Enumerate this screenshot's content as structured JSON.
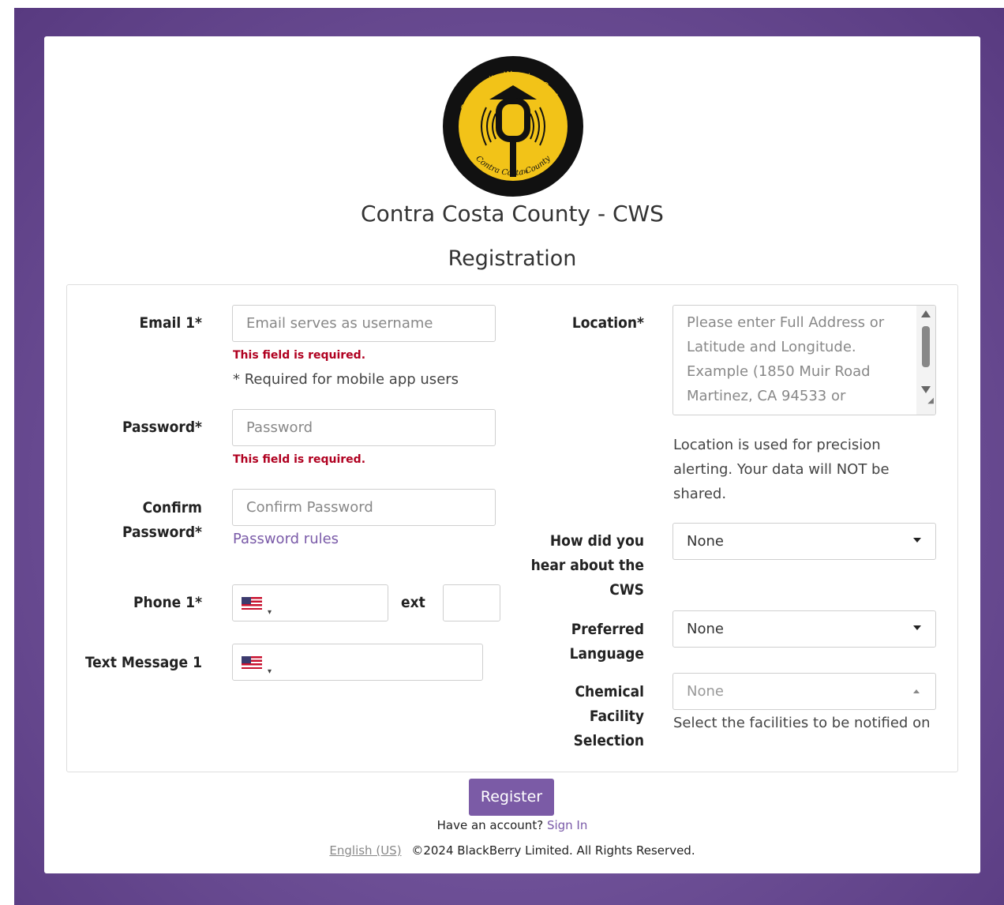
{
  "header": {
    "logo_text_top": "Community Warning System",
    "logo_text_bottom": "Contra Costa County",
    "logo_tm": "TM",
    "app_title": "Contra Costa County - CWS",
    "page_heading": "Registration"
  },
  "form": {
    "email": {
      "label": "Email 1*",
      "placeholder": "Email serves as username",
      "error": "This field is required.",
      "hint": "* Required for mobile app users"
    },
    "password": {
      "label": "Password*",
      "placeholder": "Password",
      "error": "This field is required."
    },
    "confirm_password": {
      "label_line1": "Confirm",
      "label_line2": "Password*",
      "placeholder": "Confirm Password",
      "rules_link": "Password rules"
    },
    "phone": {
      "label": "Phone 1*",
      "ext_label": "ext",
      "ext_value": ""
    },
    "text_message": {
      "label": "Text Message 1"
    },
    "location": {
      "label": "Location*",
      "placeholder": "Please enter Full Address or Latitude and Longitude. Example (1850 Muir Road Martinez,  CA 94533 or",
      "hint": "Location is used for precision alerting. Your data will NOT be shared."
    },
    "how_heard": {
      "label_line1": "How did you",
      "label_line2": "hear about the",
      "label_line3": "CWS",
      "value": "None"
    },
    "preferred_language": {
      "label_line1": "Preferred",
      "label_line2": "Language",
      "value": "None"
    },
    "chemical_facility": {
      "label_line1": "Chemical",
      "label_line2": "Facility",
      "label_line3": "Selection",
      "value": "None",
      "hint": "Select the facilities to be notified on"
    }
  },
  "actions": {
    "register_label": "Register",
    "have_account_text": "Have an account?",
    "sign_in_link": "Sign In"
  },
  "footer": {
    "language_link": "English (US)",
    "copyright": "©2024 BlackBerry Limited. All Rights Reserved."
  },
  "colors": {
    "brand_purple": "#7b5ba6",
    "background_purple": "#6d4f96",
    "error_red": "#b00020",
    "logo_yellow": "#f2c318"
  },
  "icons": {
    "flag": "us-flag-icon",
    "dropdown": "caret-down-icon"
  }
}
